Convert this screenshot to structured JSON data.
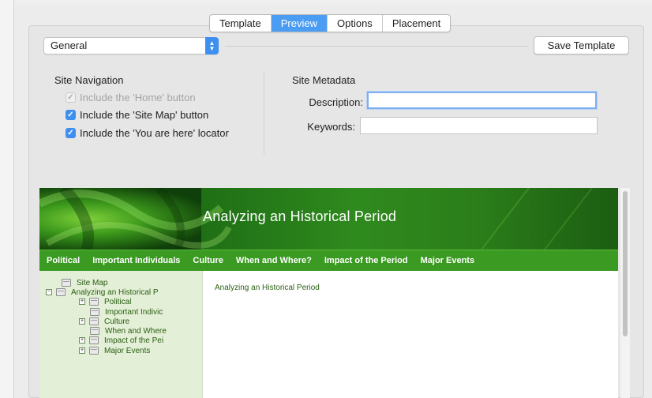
{
  "tabs": [
    {
      "label": "Template",
      "active": false
    },
    {
      "label": "Preview",
      "active": true
    },
    {
      "label": "Options",
      "active": false
    },
    {
      "label": "Placement",
      "active": false
    }
  ],
  "general_select": {
    "value": "General"
  },
  "save_template_label": "Save Template",
  "site_navigation": {
    "title": "Site Navigation",
    "options": [
      {
        "label": "Include the 'Home' button",
        "checked": true,
        "disabled": true
      },
      {
        "label": "Include the 'Site Map' button",
        "checked": true,
        "disabled": false
      },
      {
        "label": "Include the 'You are here' locator",
        "checked": true,
        "disabled": false
      }
    ]
  },
  "site_metadata": {
    "title": "Site Metadata",
    "description_label": "Description:",
    "description_value": "",
    "keywords_label": "Keywords:",
    "keywords_value": ""
  },
  "preview": {
    "banner_title": "Analyzing an Historical Period",
    "nav_items": [
      "Political",
      "Important Individuals",
      "Culture",
      "When and Where?",
      "Impact of the Period",
      "Major Events"
    ],
    "tree": [
      {
        "label": "Site Map",
        "toggle": ""
      },
      {
        "label": "Analyzing an Historical P",
        "toggle": "−"
      },
      {
        "label": "Political",
        "toggle": "+"
      },
      {
        "label": "Important Indivic",
        "toggle": ""
      },
      {
        "label": "Culture",
        "toggle": "+"
      },
      {
        "label": "When and Where",
        "toggle": ""
      },
      {
        "label": "Impact of the Pei",
        "toggle": "+"
      },
      {
        "label": "Major Events",
        "toggle": "+"
      }
    ],
    "content_text": "Analyzing an Historical Period"
  },
  "colors": {
    "accent": "#3d8ff0",
    "banner_green": "#2f8a1e",
    "nav_green": "#3b9a22",
    "sidebar_bg": "#e3efd6"
  }
}
